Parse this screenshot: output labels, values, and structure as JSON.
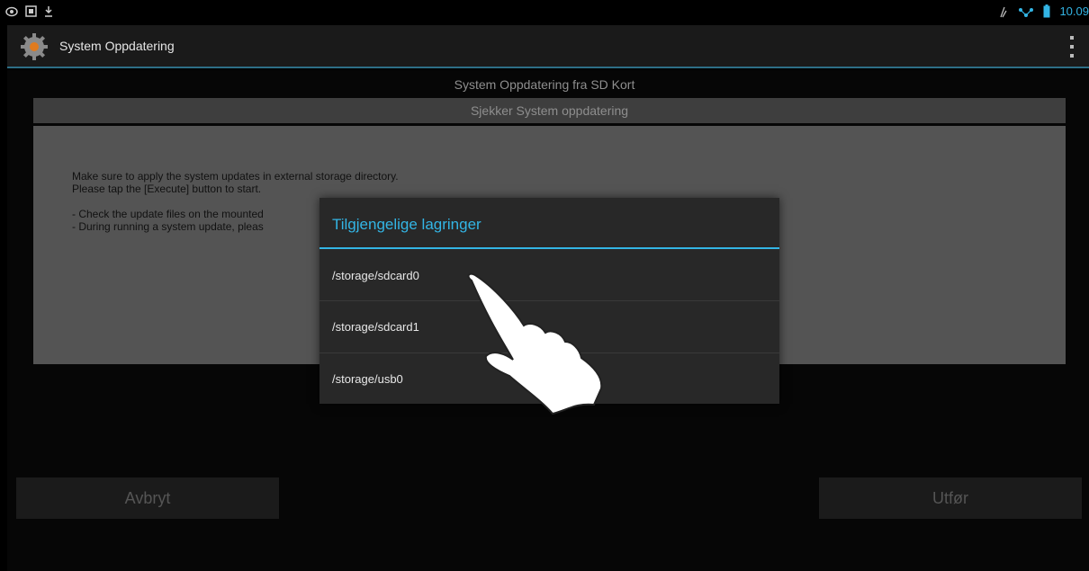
{
  "status_bar": {
    "left_icons": [
      "eye-icon",
      "screenshot-icon",
      "download-icon"
    ],
    "right_icons": [
      "signal-icon",
      "wifi-icon",
      "battery-icon"
    ],
    "time": "10.09"
  },
  "action_bar": {
    "title": "System Oppdatering",
    "app_icon": "gear-icon",
    "overflow_icon": "overflow-menu-icon"
  },
  "page": {
    "title": "System Oppdatering fra SD Kort",
    "subhead": "Sjekker System oppdatering",
    "instructions": [
      "Make sure to apply the system updates in external storage directory.",
      "Please tap the [Execute] button to start.",
      "- Check the update files on the mounted",
      "- During running a system update, pleas"
    ]
  },
  "buttons": {
    "cancel": "Avbryt",
    "execute": "Utfør"
  },
  "dialog": {
    "title": "Tilgjengelige lagringer",
    "items": [
      "/storage/sdcard0",
      "/storage/sdcard1",
      "/storage/usb0"
    ]
  },
  "colors": {
    "accent": "#33b5e5",
    "background": "#000000",
    "panel": "#545454"
  }
}
